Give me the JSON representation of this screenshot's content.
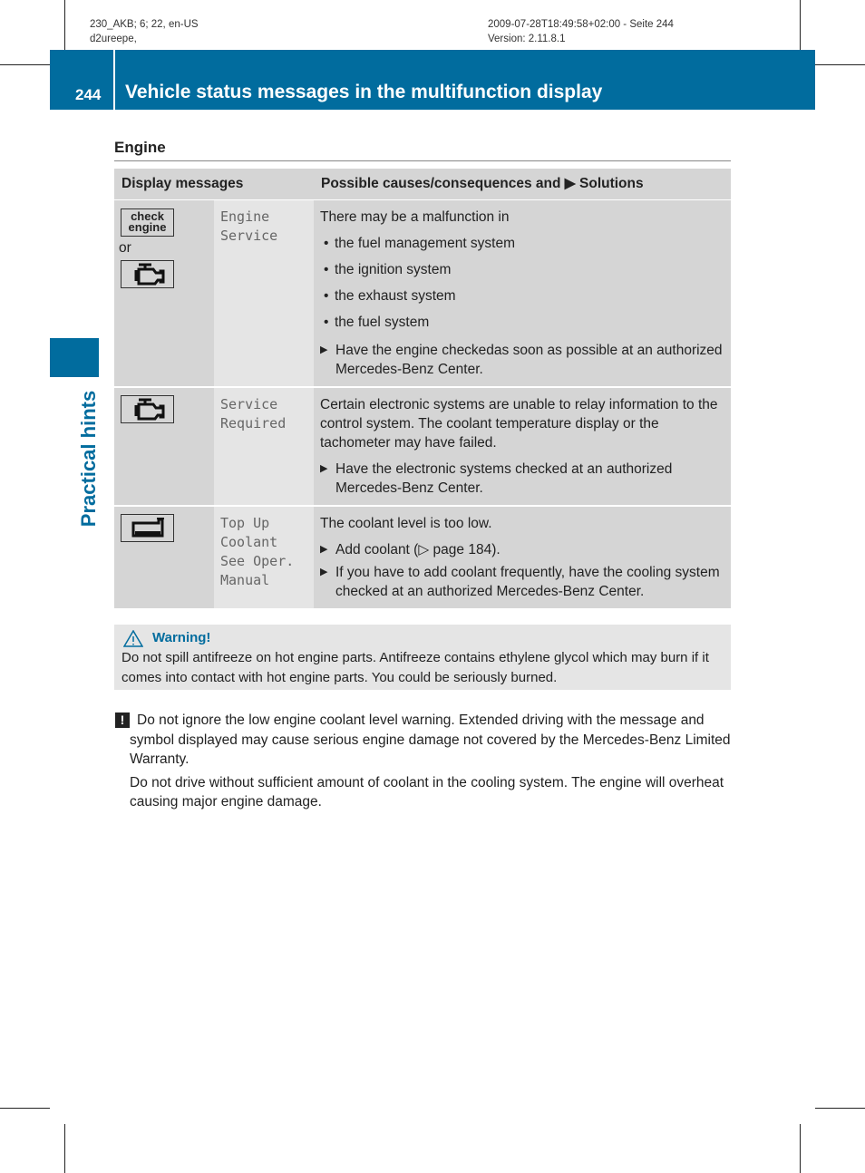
{
  "meta": {
    "left1": "230_AKB; 6; 22, en-US",
    "left2": "d2ureepe,",
    "right1": "2009-07-28T18:49:58+02:00 - Seite 244",
    "right2": "Version: 2.11.8.1"
  },
  "header": {
    "page_number": "244",
    "title": "Vehicle status messages in the multifunction display",
    "accent": "#016c9e"
  },
  "side_tab": "Practical hints",
  "section": "Engine",
  "table": {
    "headers": [
      "Display messages",
      "Possible causes/consequences and ▶ Solutions"
    ],
    "rows": [
      {
        "icons": [
          "check-engine-icon",
          "engine-icon"
        ],
        "icon_text": "check engine",
        "or": "or",
        "message": [
          "Engine",
          "Service"
        ],
        "intro": "There may be a malfunction in",
        "bullets": [
          "the fuel management system",
          "the ignition system",
          "the exhaust system",
          "the fuel system"
        ],
        "actions": [
          "Have the engine checkedas soon as possible at an authorized Mercedes-Benz Center."
        ]
      },
      {
        "icons": [
          "engine-icon"
        ],
        "message": [
          "Service",
          "Required"
        ],
        "intro": "Certain electronic systems are unable to relay information to the control system. The coolant temperature display or the tachometer may have failed.",
        "actions": [
          "Have the electronic systems checked at an authorized Mercedes-Benz Center."
        ]
      },
      {
        "icons": [
          "coolant-icon"
        ],
        "message": [
          "Top Up",
          "Coolant",
          "See Oper.",
          "Manual"
        ],
        "intro": "The coolant level is too low.",
        "actions": [
          "Add coolant (▷ page 184).",
          "If you have to add coolant frequently, have the cooling system checked at an authorized Mercedes-Benz Center."
        ]
      }
    ]
  },
  "warning": {
    "title": "Warning!",
    "text": "Do not spill antifreeze on hot engine parts. Antifreeze contains ethylene glycol which may burn if it comes into contact with hot engine parts. You could be seriously burned."
  },
  "note": {
    "icon": "!",
    "p1": "Do not ignore the low engine coolant level warning. Extended driving with the message and symbol displayed may cause serious engine damage not covered by the Mercedes-Benz Limited Warranty.",
    "p2": "Do not drive without sufficient amount of coolant in the cooling system. The engine will overheat causing major engine damage."
  }
}
